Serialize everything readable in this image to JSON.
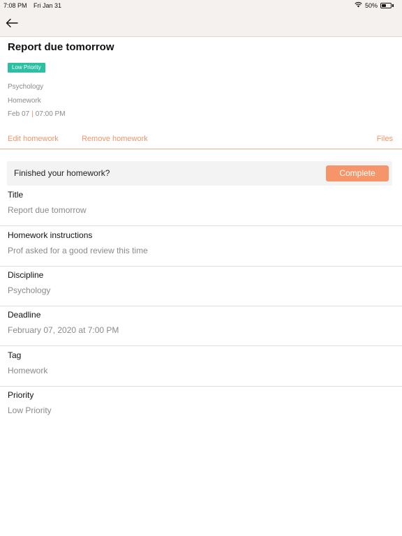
{
  "status_bar": {
    "time": "7:08 PM",
    "date": "Fri Jan 31",
    "battery": "50%",
    "battery_level": 0.5,
    "wifi_icon": "wifi-icon"
  },
  "nav": {
    "back_icon": "arrow-left-icon"
  },
  "homework": {
    "title": "Report due tomorrow",
    "priority_badge": "Low Priority",
    "discipline": "Psychology",
    "tag": "Homework",
    "date": "Feb 07",
    "separator": "|",
    "time": "07:00 PM"
  },
  "actions": {
    "edit": "Edit homework",
    "remove": "Remove homework",
    "files": "Files"
  },
  "finish": {
    "prompt": "Finished your homework?",
    "button": "Complete"
  },
  "fields": [
    {
      "label": "Title",
      "value": "Report due tomorrow"
    },
    {
      "label": "Homework instructions",
      "value": "Prof asked for a good review this time"
    },
    {
      "label": "Discipline",
      "value": "Psychology"
    },
    {
      "label": "Deadline",
      "value": "February 07, 2020 at 7:00 PM"
    },
    {
      "label": "Tag",
      "value": "Homework"
    },
    {
      "label": "Priority",
      "value": "Low Priority"
    }
  ],
  "colors": {
    "accent": "#f2956a",
    "badge": "#2bbfa4",
    "header_bg": "#f4f1ee"
  }
}
